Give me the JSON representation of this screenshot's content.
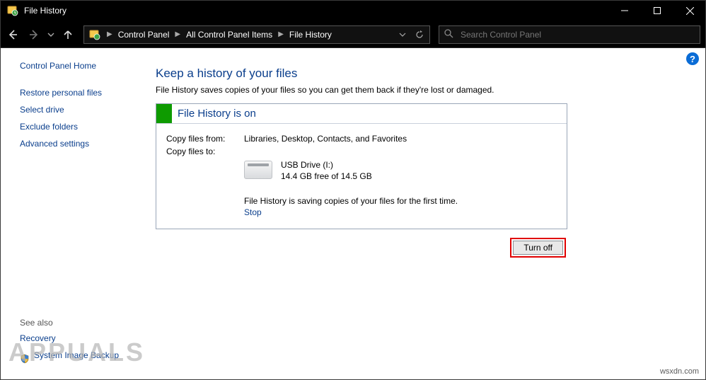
{
  "window": {
    "title": "File History"
  },
  "breadcrumbs": {
    "item1": "Control Panel",
    "item2": "All Control Panel Items",
    "item3": "File History"
  },
  "search": {
    "placeholder": "Search Control Panel"
  },
  "sidebar": {
    "home": "Control Panel Home",
    "links": {
      "restore": "Restore personal files",
      "select_drive": "Select drive",
      "exclude": "Exclude folders",
      "advanced": "Advanced settings"
    },
    "see_also_label": "See also",
    "see_also": {
      "recovery": "Recovery",
      "sys_image": "System Image Backup"
    }
  },
  "main": {
    "title": "Keep a history of your files",
    "desc": "File History saves copies of your files so you can get them back if they're lost or damaged.",
    "panel_title": "File History is on",
    "copy_from_key": "Copy files from:",
    "copy_from_val": "Libraries, Desktop, Contacts, and Favorites",
    "copy_to_key": "Copy files to:",
    "drive_name": "USB Drive (I:)",
    "drive_free": "14.4 GB free of 14.5 GB",
    "saving_msg": "File History is saving copies of your files for the first time.",
    "stop_link": "Stop",
    "turn_off_label": "Turn off"
  },
  "help_glyph": "?",
  "watermark": "APPUALS",
  "footer": "wsxdn.com"
}
